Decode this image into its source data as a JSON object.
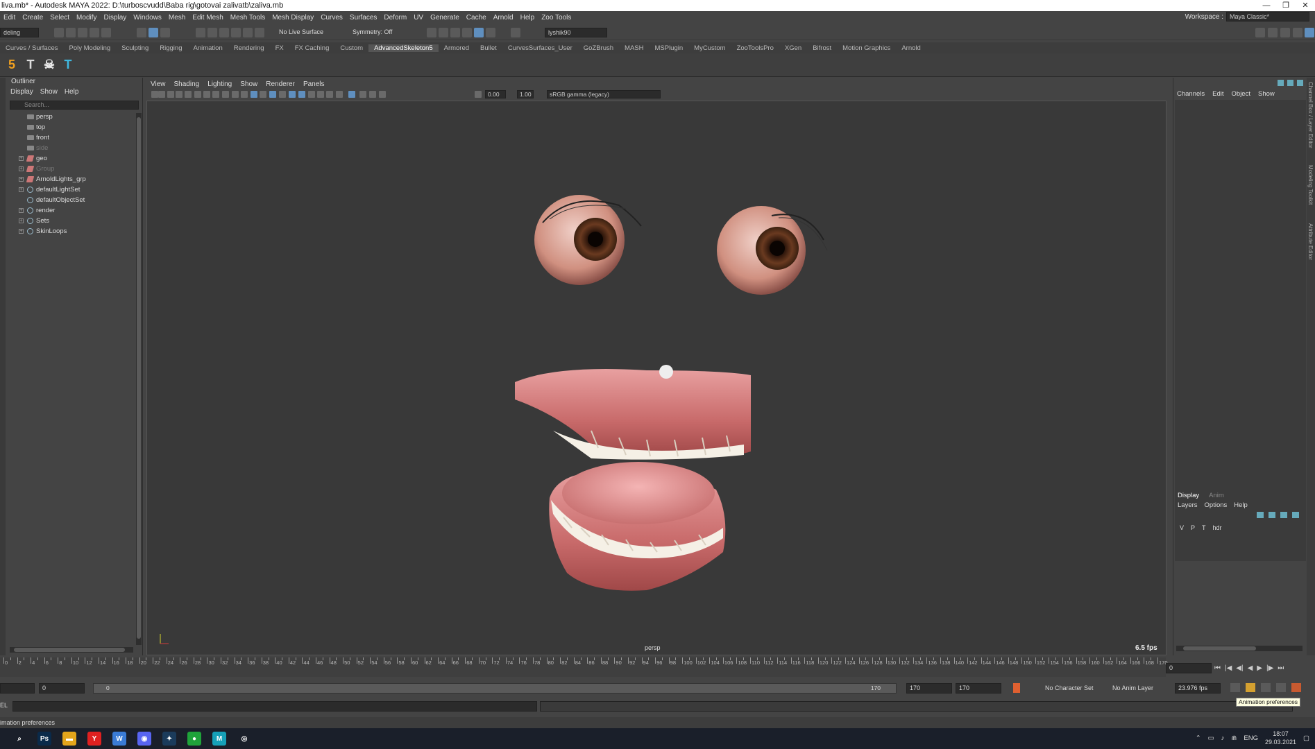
{
  "window": {
    "title": "liva.mb* - Autodesk MAYA 2022: D:\\turboscvudd\\Baba rig\\gotovai zalivatb\\zaliva.mb",
    "minimize": "—",
    "maximize": "❐",
    "close": "✕"
  },
  "menubar": [
    "Edit",
    "Create",
    "Select",
    "Modify",
    "Display",
    "Windows",
    "Mesh",
    "Edit Mesh",
    "Mesh Tools",
    "Mesh Display",
    "Curves",
    "Surfaces",
    "Deform",
    "UV",
    "Generate",
    "Cache",
    "Arnold",
    "Help",
    "Zoo Tools"
  ],
  "workspace": {
    "label": "Workspace :",
    "value": "Maya Classic*"
  },
  "statusline": {
    "menu_set": "deling",
    "live_surface": "No Live Surface",
    "symmetry": "Symmetry: Off",
    "user": "lyshik90"
  },
  "shelf_tabs": [
    "Curves / Surfaces",
    "Poly Modeling",
    "Sculpting",
    "Rigging",
    "Animation",
    "Rendering",
    "FX",
    "FX Caching",
    "Custom",
    "AdvancedSkeleton5",
    "Armored",
    "Bullet",
    "CurvesSurfaces_User",
    "GoZBrush",
    "MASH",
    "MSPlugin",
    "MyCustom",
    "ZooToolsPro",
    "XGen",
    "Bifrost",
    "Motion Graphics",
    "Arnold"
  ],
  "shelf_tab_active": "AdvancedSkeleton5",
  "shelf_icons": [
    {
      "glyph": "5",
      "color": "#f0a020"
    },
    {
      "glyph": "T",
      "color": "#dddddd"
    },
    {
      "glyph": "☠",
      "color": "#eeeeee"
    },
    {
      "glyph": "T",
      "color": "#3fb8e0"
    }
  ],
  "outliner": {
    "title": "Outliner",
    "menu": [
      "Display",
      "Show",
      "Help"
    ],
    "search_placeholder": "Search...",
    "items": [
      {
        "label": "persp",
        "type": "cam",
        "expand": "",
        "dim": false
      },
      {
        "label": "top",
        "type": "cam",
        "expand": "",
        "dim": false
      },
      {
        "label": "front",
        "type": "cam",
        "expand": "",
        "dim": false
      },
      {
        "label": "side",
        "type": "cam",
        "expand": "",
        "dim": true
      },
      {
        "label": "geo",
        "type": "grp",
        "expand": "+",
        "dim": false
      },
      {
        "label": "Group",
        "type": "grp",
        "expand": "+",
        "dim": true
      },
      {
        "label": "ArnoldLights_grp",
        "type": "grp",
        "expand": "+",
        "dim": false
      },
      {
        "label": "defaultLightSet",
        "type": "set",
        "expand": "+",
        "dim": false
      },
      {
        "label": "defaultObjectSet",
        "type": "set",
        "expand": "",
        "dim": false
      },
      {
        "label": "render",
        "type": "set",
        "expand": "+",
        "dim": false
      },
      {
        "label": "Sets",
        "type": "set",
        "expand": "+",
        "dim": false
      },
      {
        "label": "SkinLoops",
        "type": "set",
        "expand": "+",
        "dim": false
      }
    ]
  },
  "panel": {
    "menu": [
      "View",
      "Shading",
      "Lighting",
      "Show",
      "Renderer",
      "Panels"
    ],
    "exposure": "0.00",
    "gamma": "1.00",
    "color_space": "sRGB gamma (legacy)",
    "camera_label": "persp",
    "fps": "6.5 fps"
  },
  "channel_box": {
    "menu": [
      "Channels",
      "Edit",
      "Object",
      "Show"
    ],
    "layer_tabs": [
      "Display",
      "Anim"
    ],
    "layer_tab_active": "Display",
    "layer_menu": [
      "Layers",
      "Options",
      "Help"
    ],
    "layer_row": {
      "v": "V",
      "p": "P",
      "t": "T",
      "name": "hdr"
    }
  },
  "side_tabs": [
    "Channel Box / Layer Editor",
    "Modeling Toolkit",
    "Attribute Editor"
  ],
  "timeline": {
    "ticks": [
      "0",
      "2",
      "4",
      "6",
      "8",
      "10",
      "12",
      "14",
      "16",
      "18",
      "20",
      "22",
      "24",
      "26",
      "28",
      "30",
      "32",
      "34",
      "36",
      "38",
      "40",
      "42",
      "44",
      "46",
      "48",
      "50",
      "52",
      "54",
      "56",
      "58",
      "60",
      "62",
      "64",
      "66",
      "68",
      "70",
      "72",
      "74",
      "76",
      "78",
      "80",
      "82",
      "84",
      "86",
      "88",
      "90",
      "92",
      "94",
      "96",
      "98",
      "100",
      "102",
      "104",
      "106",
      "108",
      "110",
      "112",
      "114",
      "116",
      "118",
      "120",
      "122",
      "124",
      "126",
      "128",
      "130",
      "132",
      "134",
      "136",
      "138",
      "140",
      "142",
      "144",
      "146",
      "148",
      "150",
      "152",
      "154",
      "156",
      "158",
      "160",
      "162",
      "164",
      "166",
      "168",
      "170"
    ],
    "current_frame": "0"
  },
  "range": {
    "start": "0",
    "inner_start": "0",
    "inner_end": "170",
    "end": "170",
    "end2": "170",
    "character_set": "No Character Set",
    "anim_layer": "No Anim Layer",
    "fps": "23.976 fps"
  },
  "cmdline": {
    "lang": "EL"
  },
  "helpline": "imation preferences",
  "tooltip": "Animation preferences",
  "taskbar": {
    "apps": [
      {
        "label": "⌕",
        "color": "transparent"
      },
      {
        "label": "Ps",
        "color": "#0a2a4a"
      },
      {
        "label": "▬",
        "color": "#e3a51b"
      },
      {
        "label": "Y",
        "color": "#e02020"
      },
      {
        "label": "W",
        "color": "#3a7bd5"
      },
      {
        "label": "◉",
        "color": "#5865f2"
      },
      {
        "label": "✦",
        "color": "#1b3b5b"
      },
      {
        "label": "●",
        "color": "#1fa33a"
      },
      {
        "label": "M",
        "color": "#16a0b8"
      },
      {
        "label": "◎",
        "color": "transparent"
      }
    ],
    "lang": "ENG",
    "time": "18:07",
    "date": "29.03.2021"
  }
}
